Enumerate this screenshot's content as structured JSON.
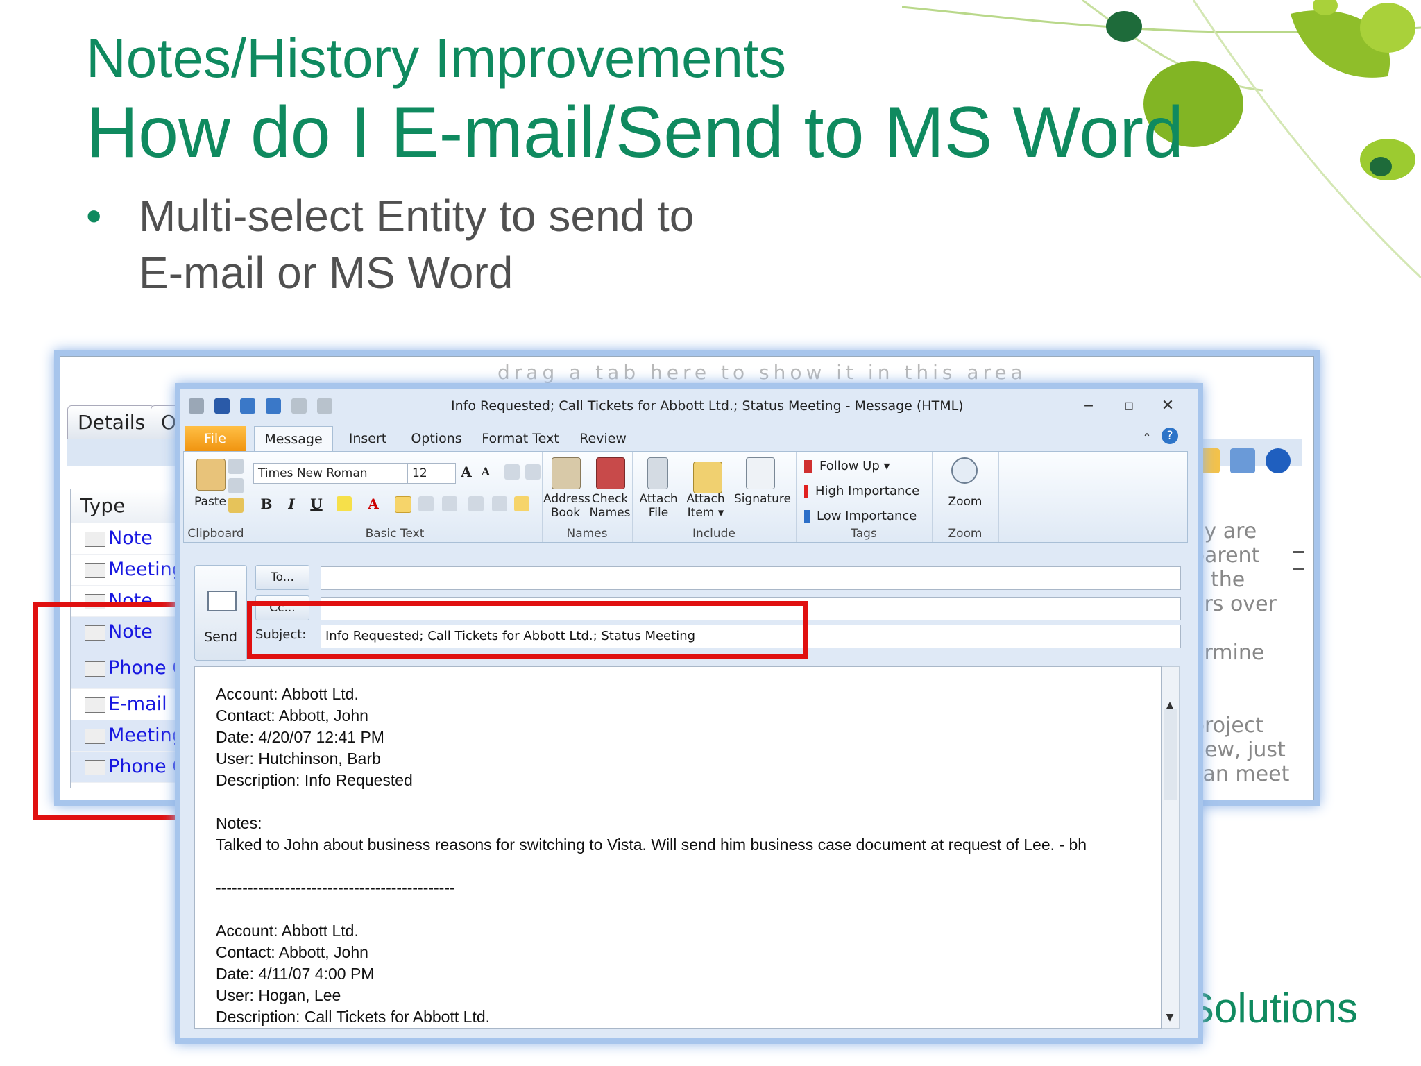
{
  "slide": {
    "title1": "Notes/History Improvements",
    "title2": "How do I E-mail/Send to MS Word",
    "bullet_symbol": "•",
    "bullet_line1": "Multi-select Entity to send to",
    "bullet_line2": "E-mail or MS Word",
    "brand_fragment": "Solutions"
  },
  "bg_app": {
    "drag_hint": "drag a tab here to show it in this area",
    "tabs": [
      "Details",
      "O"
    ],
    "type_header": "Type",
    "type_rows": [
      "Note",
      "Meeting",
      "Note",
      "Note",
      "Phone C",
      "E-mail",
      "Meeting",
      "Phone C"
    ],
    "right_text": [
      "ey are",
      "parent",
      "e the",
      "ers over",
      "-",
      "ermine",
      "project",
      "new, just",
      "can meet"
    ]
  },
  "message_window": {
    "title": "Info Requested; Call Tickets for Abbott Ltd.; Status Meeting  -  Message (HTML)",
    "tabs": [
      "File",
      "Message",
      "Insert",
      "Options",
      "Format Text",
      "Review"
    ],
    "ribbon": {
      "paste": "Paste",
      "clipboard": "Clipboard",
      "font_name": "Times New Roman",
      "font_size": "12",
      "basic_text": "Basic Text",
      "address_book": [
        "Address",
        "Book"
      ],
      "check_names": [
        "Check",
        "Names"
      ],
      "names": "Names",
      "attach_file": [
        "Attach",
        "File"
      ],
      "attach_item": [
        "Attach",
        "Item ▾"
      ],
      "signature": "Signature",
      "include": "Include",
      "follow_up": "Follow Up ▾",
      "high_importance": "High Importance",
      "low_importance": "Low Importance",
      "tags": "Tags",
      "zoom": "Zoom",
      "zoom_group": "Zoom"
    },
    "send": "Send",
    "to_button": "To...",
    "cc_button": "Cc...",
    "subject_label": "Subject:",
    "subject": "Info Requested; Call Tickets for Abbott Ltd.; Status Meeting",
    "body_lines": [
      "Account: Abbott Ltd.",
      "Contact: Abbott, John",
      "Date: 4/20/07 12:41 PM",
      "User: Hutchinson, Barb",
      "Description: Info Requested",
      "",
      "Notes:",
      "Talked to John about business reasons for switching to Vista.  Will send him business case document at request of Lee. - bh",
      "",
      "---------------------------------------------",
      "",
      "Account: Abbott Ltd.",
      "Contact: Abbott, John",
      "Date: 4/11/07 4:00 PM",
      "User: Hogan, Lee",
      "Description: Call Tickets for Abbott Ltd."
    ]
  },
  "colors": {
    "title_green": "#0f8a5f",
    "highlight_red": "#e01010",
    "file_tab_orange": "#f5a623",
    "link_blue": "#1818e0"
  }
}
